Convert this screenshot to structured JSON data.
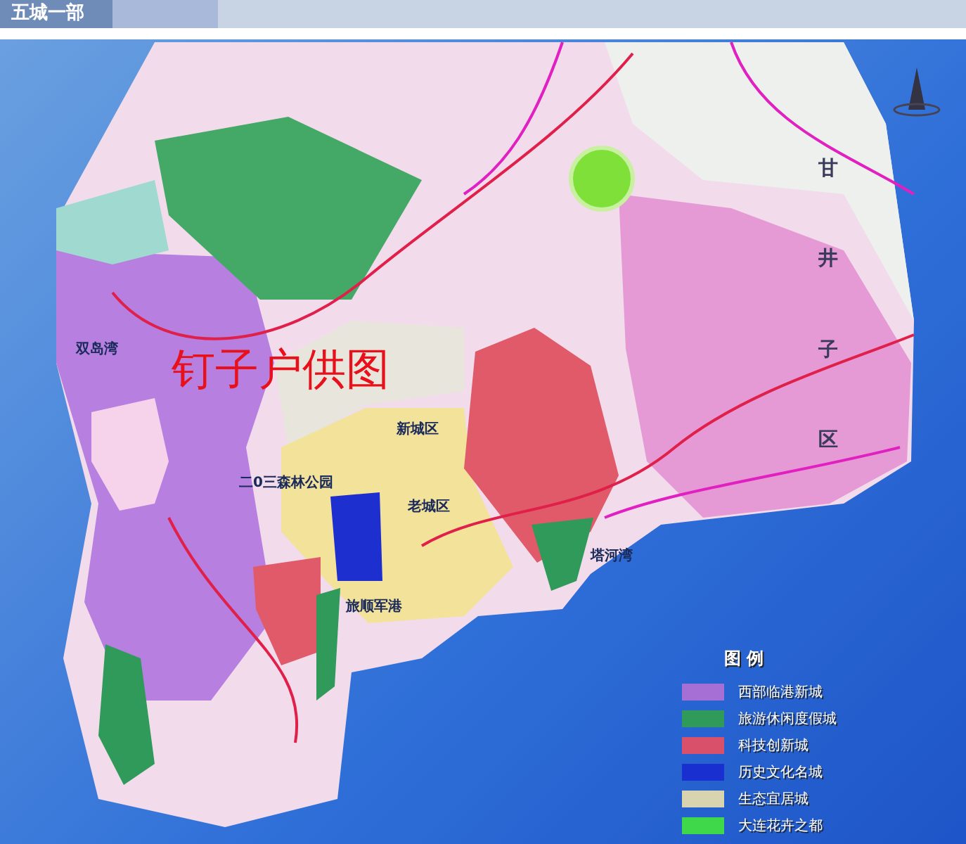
{
  "header": {
    "title": "五城一部"
  },
  "map": {
    "overlay_text": "钉子户供图",
    "labels": [
      {
        "text": "双岛湾",
        "kind": "place"
      },
      {
        "text": "二0三森林公园",
        "kind": "place"
      },
      {
        "text": "新城区",
        "kind": "place"
      },
      {
        "text": "老城区",
        "kind": "place"
      },
      {
        "text": "旅顺军港",
        "kind": "place"
      },
      {
        "text": "塔河湾",
        "kind": "place"
      },
      {
        "text": "甘井子区",
        "kind": "vertical"
      }
    ],
    "legend": {
      "title": "图 例",
      "items": [
        {
          "label": "西部临港新城",
          "color": "#a66fd6"
        },
        {
          "label": "旅游休闲度假城",
          "color": "#2f9a5a"
        },
        {
          "label": "科技创新城",
          "color": "#d9506a"
        },
        {
          "label": "历史文化名城",
          "color": "#1a2fd0"
        },
        {
          "label": "生态宜居城",
          "color": "#d8d4b0"
        },
        {
          "label": "大连花卉之都",
          "color": "#3fd84a"
        }
      ]
    }
  }
}
